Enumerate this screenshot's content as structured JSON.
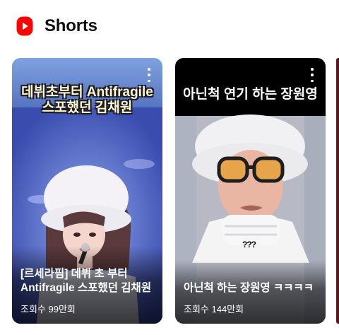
{
  "section": {
    "title": "Shorts",
    "logo_icon": "youtube-shorts-logo",
    "accent": "#ff0000"
  },
  "cards": [
    {
      "overlay_line1": "데뷔초부터 Antifragile",
      "overlay_line2": "스포했던 김채원",
      "title": "[르세라핌] 데뷔 초 부터 Antifragile 스포했던 김채원",
      "views": "조회수 99만회",
      "menu_icon": "more-vert-icon"
    },
    {
      "overlay_line1": "아닌척 연기 하는 장원영",
      "title": "아닌척 하는 장원영 ㅋㅋㅋㅋ",
      "views": "조회수 144만회",
      "menu_icon": "more-vert-icon",
      "caption_badge": "???"
    }
  ]
}
